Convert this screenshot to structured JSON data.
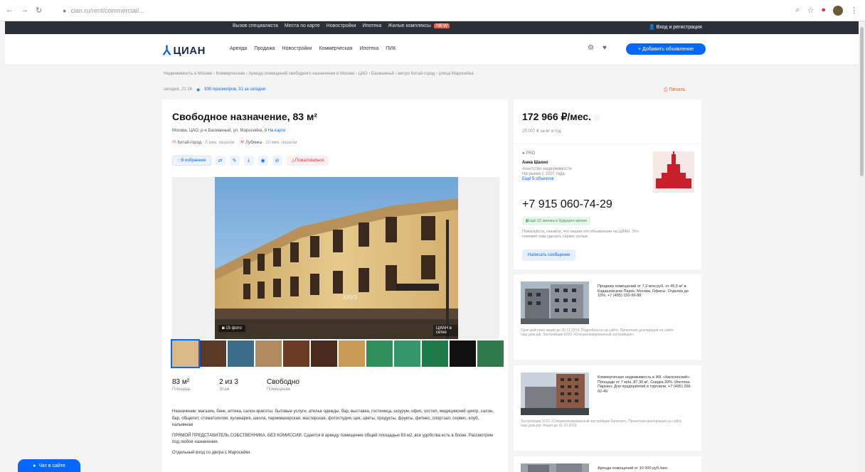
{
  "browser": {
    "url": "cian.ru/rent/commercial/...",
    "nav_icons": [
      "back-icon",
      "forward-icon",
      "reload-icon"
    ]
  },
  "topstrip": {
    "links": [
      "Вызов специалиста",
      "Места по карте",
      "Новостройки",
      "Ипотека",
      "Жилые комплексы"
    ],
    "new_badge": "NEW",
    "login": "Вход и регистрация"
  },
  "header": {
    "logo": "ЦИАН",
    "nav": [
      "Аренда",
      "Продажа",
      "Новостройки",
      "Коммерческая",
      "Ипотека",
      "ПИК"
    ],
    "add_button": "+ Добавить объявление"
  },
  "breadcrumb": "Недвижимость в Москве › Коммерческая › Аренда помещений свободного назначения в Москве › ЦАО › Басманный › метро Китай-город › улица Маросейка",
  "meta": {
    "updated": "сегодня, 21:16",
    "views": "930 просмотров, 31 за сегодня"
  },
  "print_link": "Печать",
  "listing": {
    "title": "Свободное назначение, 83 м²",
    "address": "Москва, ЦАО, р-н Басманный, ул. Маросейка, 8",
    "map_link": "На карте",
    "metro": [
      {
        "name": "Китай-город",
        "time": "5 мин. пешком"
      },
      {
        "name": "Лубянка",
        "time": "10 мин. пешком"
      }
    ],
    "favorite": "В избранное",
    "complain": "Пожаловаться",
    "photo_count": "15 фото",
    "watermark": "ЦИАН в сетке",
    "sign_text": "ХАУЗ",
    "thumb_colors": [
      "#d9b986",
      "#5a3a26",
      "#3b6c8a",
      "#b08a5a",
      "#6b3a22",
      "#4a2a1c",
      "#c99a55",
      "#2f8f5a",
      "#35966a",
      "#1f7a4a",
      "#111111",
      "#2f7a4a"
    ],
    "params": [
      {
        "value": "83 м²",
        "label": "Площадь"
      },
      {
        "value": "2 из 3",
        "label": "Этаж"
      },
      {
        "value": "Свободно",
        "label": "Помещение"
      }
    ],
    "description": [
      "Назначение: магазин, банк, аптека, салон красоты, бытовые услуги, ателье одежды, бар, выставка, гостиница, шоурум, офис, хостел, медицинский центр, салон, бар, общепит, стоматология, кулинария, школа, парикмахерская, мастерская, фотостудия, цех, цветы, продукты, фрукты, фитнес, спортзал, сервис, клуб, кальянная",
      "ПРЯМОЙ ПРЕДСТАВИТЕЛЬ СОБСТВЕННИКА. БЕЗ КОМИССИИ. Сдается в аренду помещение общей площадью 83 м2, все удобства есть в блоке. Рассмотрим под любое назначение.",
      "Отдельный вход со двора с Маросейки."
    ]
  },
  "price": {
    "value": "172 966 ₽/мес.",
    "per_sqm": "25 007 ₽ за м² в год"
  },
  "agent": {
    "pro": "PRO",
    "name": "Анна Шахно",
    "role": "Агентство недвижимости",
    "since": "На рынке с 2007 года",
    "more": "Ещё 5 объектов",
    "phone": "+7 915 060-74-29",
    "call_note": "Ещё 22 звонка в будущее время",
    "call_sub": "Пожалуйста, скажите, что нашли это объявление на ЦИАН. Это поможет нам сделать сервис лучше.",
    "message_button": "Написать сообщение"
  },
  "ads": [
    {
      "text": "Продажа помещений от 7,3 млн руб. от 45,5 м² в Кадашевском Парке, Москва. Офисы. Отделка до 10%. +7 (495) 150-99-88",
      "foot": "Срок действия акции до 30.11.2019. Подробности на сайте. Проектная декларация на сайте наш.дом.рф. Застройщик ООО «Специализированный застройщик»."
    },
    {
      "text": "Коммерческая недвижимость в ЖК «Нагатинский». Площади от 7 млн. 87,30 м². Скидка 20%. Ипотека. Паркинг. Для предприятий и торговли. +7 (495) 266-02-49",
      "foot": "Застройщик ООО «Специализированный застройщик Капитал». Проектная декларация на сайте наш.дом.рф. Акция до 31.10.2019."
    },
    {
      "text": "Аренда помещений от 10 000 руб./мес"
    }
  ],
  "chat_button": "Чат в сайте"
}
